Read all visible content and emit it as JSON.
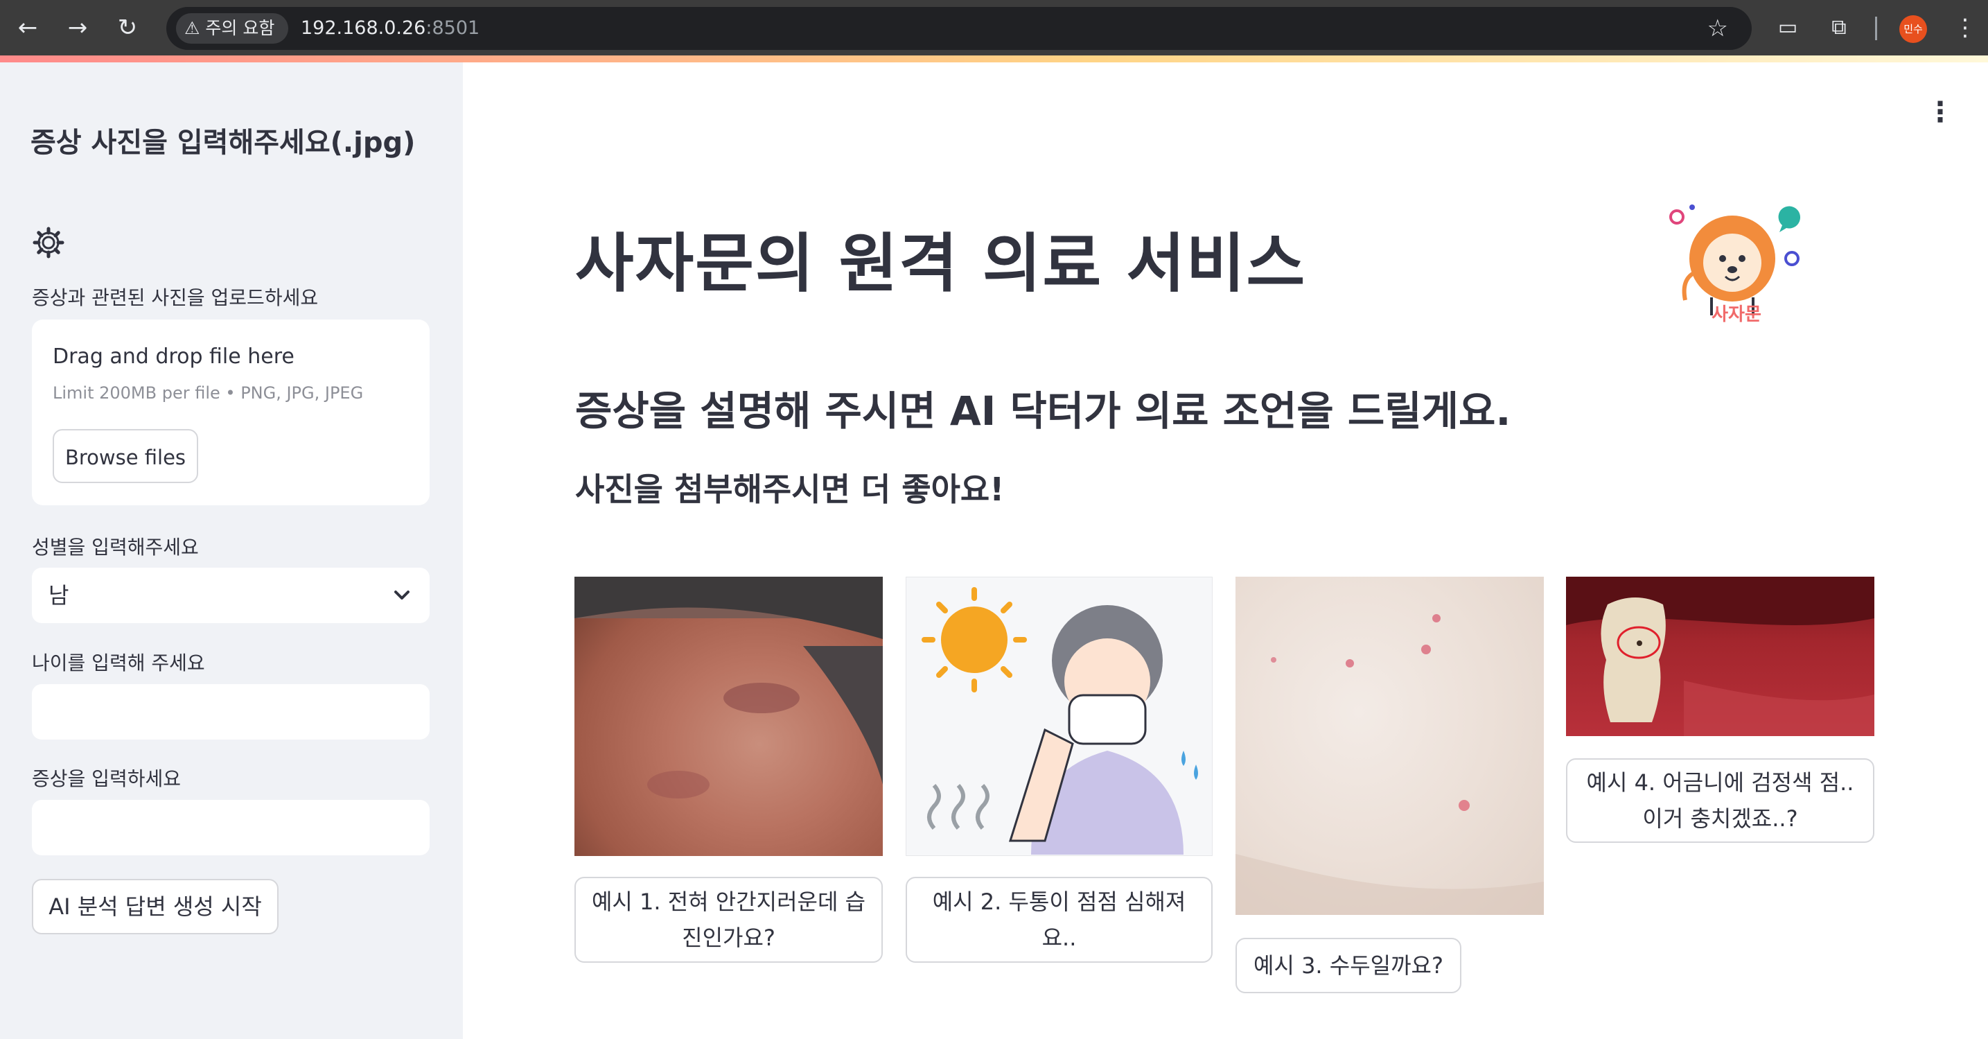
{
  "browser": {
    "security_label": "주의 요함",
    "url_host": "192.168.0.26",
    "url_port": ":8501",
    "profile_initials": "민수"
  },
  "sidebar": {
    "title": "증상 사진을 입력해주세요(.jpg)",
    "upload_label": "증상과 관련된 사진을 업로드하세요",
    "upload": {
      "drag_text": "Drag and drop file here",
      "limit_text": "Limit 200MB per file • PNG, JPG, JPEG",
      "browse_label": "Browse files"
    },
    "gender_label": "성별을 입력해주세요",
    "gender_value": "남",
    "age_label": "나이를 입력해 주세요",
    "age_value": "",
    "symptom_label": "증상을 입력하세요",
    "symptom_value": "",
    "generate_label": "AI 분석 답변 생성 시작"
  },
  "main": {
    "title": "사자문의 원격 의료 서비스",
    "subtitle": "증상을 설명해 주시면 AI 닥터가 의료 조언을 드릴게요.",
    "subtitle2": "사진을 첨부해주시면 더 좋아요!",
    "logo_text": "사자문",
    "examples": [
      {
        "label": "예시 1. 전혀 안간지러운데 습진인가요?"
      },
      {
        "label": "예시 2. 두통이 점점 심해져요.."
      },
      {
        "label": "예시 3. 수두일까요?"
      },
      {
        "label": "예시 4. 어금니에 검정색 점.. 이거 충치겠죠..?"
      }
    ]
  },
  "colors": {
    "sidebar_bg": "#f0f2f6",
    "text": "#31333f",
    "chrome": "#3c3c3c",
    "accent": "#ff4b4b"
  }
}
